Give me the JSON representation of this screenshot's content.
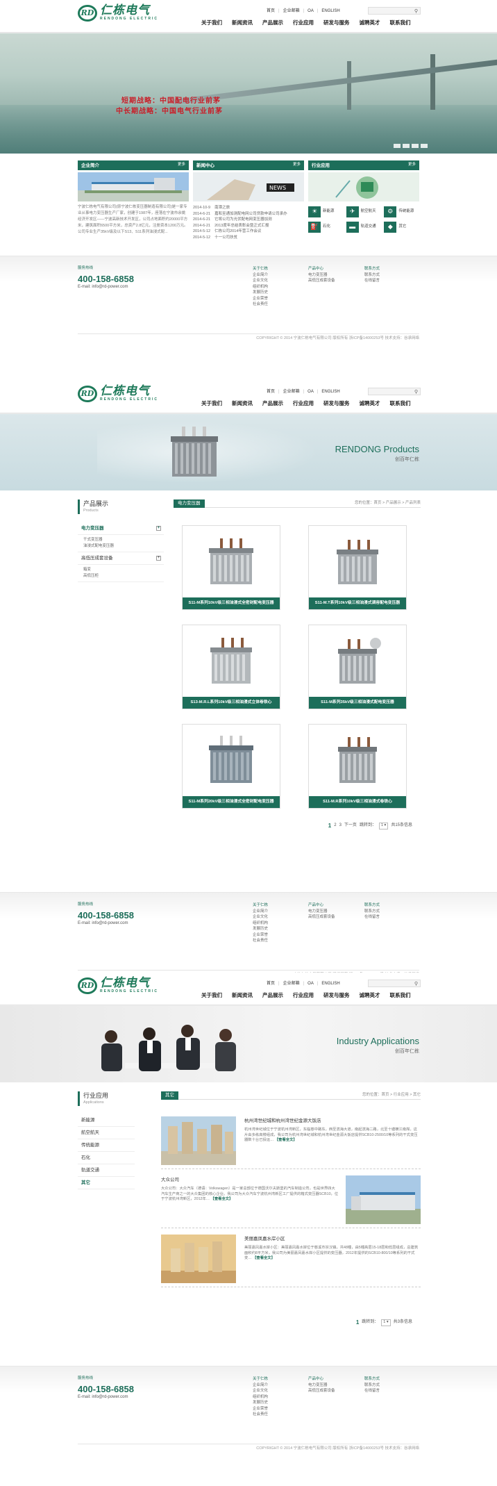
{
  "header": {
    "logo_cn": "仁栋电气",
    "logo_en": "RENDONG ELECTRIC",
    "logo_mark": "RD",
    "toplinks": [
      "首页",
      "企业邮箱",
      "OA",
      "ENGLISH"
    ],
    "nav": [
      "关于我们",
      "新闻资讯",
      "产品展示",
      "行业应用",
      "研发与服务",
      "诚聘英才",
      "联系我们"
    ],
    "search_icon": "search-icon"
  },
  "home": {
    "slogan_1": "短期战略：中国配电行业前茅",
    "slogan_2": "中长期战略：中国电气行业前茅",
    "company": {
      "title": "企业简介",
      "more": "更多",
      "text": "宁波仁栋电气有限公司(原宁波仁栋变压器制造有限公司)是一家专业从事电力变压器生产厂家，创建于1987年，座落在宁波市余姚经济开发区——宁波高新技术开发区，公司占地面积约20000平方米，建筑面积6500平方米，总资产2.8亿元，注册资本1200万元。公司专业生产35kV级及以下S13、S11系列油浸式配..."
    },
    "news": {
      "title": "新闻中心",
      "more": "更多",
      "items": [
        {
          "date": "2014-10-9",
          "text": "南潭之旅"
        },
        {
          "date": "2014-6-21",
          "text": "嘉和至通加测配电网公司贷款申请公司承办"
        },
        {
          "date": "2014-6-21",
          "text": "它将公司为光伏配电网变压器加测"
        },
        {
          "date": "2014-6-21",
          "text": "2013度年总结表彰会暨正式汇报"
        },
        {
          "date": "2014-5-12",
          "text": "仁栋公司2014年营工作会议"
        },
        {
          "date": "2014-5-12",
          "text": "十一公司扶贫"
        }
      ]
    },
    "industry": {
      "title": "行业应用",
      "more": "更多",
      "items": [
        "新能源",
        "航空航天",
        "传统能源",
        "石化",
        "轨道交通",
        "其它"
      ]
    }
  },
  "footer": {
    "hotline_label": "服务热线",
    "hotline": "400-158-6858",
    "email": "E-mail: info@rd-power.com",
    "col1": {
      "title": "关于仁栋",
      "items": [
        "企业简介",
        "企业文化",
        "组织机构",
        "发展历史",
        "企业荣誉",
        "社会责任"
      ]
    },
    "col2": {
      "title": "产品中心",
      "items": [
        "电力变压器",
        "高低压成套设备"
      ]
    },
    "col3": {
      "title": "联系方式",
      "items": [
        "联系方式",
        "在线留言"
      ]
    },
    "copyright": "COPYRIGHT © 2014 宁波仁栋电气有限公司 版权所有 浙ICP备14000253号",
    "tech": "技术支持：谷承网络"
  },
  "products": {
    "banner_title": "RENDONG  Products",
    "banner_sub": "创百年仁栋",
    "side_title": "产品展示",
    "side_sub": "Products",
    "cat1": "电力变压器",
    "cat1_sub": [
      "干式变压器",
      "油浸式配电变压器"
    ],
    "cat2": "高低压成套设备",
    "cat2_sub": [
      "箱变",
      "高低压柜"
    ],
    "tag": "电力变压器",
    "crumb": "您的位置：首页 > 产品展示 > 产品列表",
    "items": [
      "S11-M系列10kV级三相油浸式全密封配电变压器",
      "S11-M.T系列10kV级三相油浸式调容配电变压器",
      "S13-M.R.L系列10kV级三相油浸式立体卷铁心",
      "S11-M系列35kV级三相油浸式配电变压器",
      "S11-M系列20kV级三相油浸式全密封配电变压器",
      "S11-M.R系列10kV级三相油浸式卷铁心"
    ],
    "pager": {
      "pages": [
        "1",
        "2",
        "3"
      ],
      "next": "下一页",
      "goto": "跳转到：",
      "sel": "1",
      "total": "共15条信息"
    }
  },
  "apps": {
    "banner_title": "Industry Applications",
    "banner_sub": "创百年仁栋",
    "side_title": "行业应用",
    "side_sub": "Applications",
    "side_items": [
      "新能源",
      "航空航天",
      "传统能源",
      "石化",
      "轨道交通",
      "其它"
    ],
    "tag": "其它",
    "crumb": "您的位置：首页 > 行业应用 > 其它",
    "items": [
      {
        "title": "杭州湾世纪城和杭州湾世纪金源大饭店",
        "desc": "杭州湾世纪城位于宁波杭州湾新区，东临慈中路东，西至滨海大道，南起滨海二路，北至十塘横江南岸。这片由多栋高楼组成，我公司为杭州湾世纪城和杭州湾世纪金源大饭店提供SCB10-2500/10等系列的干式变压器数十台已投运…",
        "more": "【查看全文】"
      },
      {
        "title": "大众公司",
        "desc": "大众公司：大众汽车（德语：Volkswagen）是一家总部位于德国沃尔夫斯堡的汽车制造公司，也是世界四大汽车生产商之一的大众集团的核心企业。我公司为大众汽车宁波杭州湾新区工厂提供的箱式变压器SCB10，位于宁波杭州湾新区，2012年…",
        "more": "【查看全文】"
      },
      {
        "title": "美丽嘉凤嘉水岸小区",
        "desc": "美丽嘉凤嘉水岸小区：美丽嘉凤嘉水岸位于慈溪市宗汉镇，共48幢，由5幢高层15-18层和低层组成，总建筑面积约8平方米，我公司为美丽嘉凤嘉水岸小区提供的变压器，2012年提供的SCB10-800/10等系列的干式变…",
        "more": "【查看全文】"
      }
    ],
    "pager": {
      "cur": "1",
      "goto": "跳转到：",
      "sel": "1",
      "total": "共3条信息"
    }
  },
  "colors": {
    "brand": "#1d6e5a",
    "slogan": "#c8202a"
  }
}
